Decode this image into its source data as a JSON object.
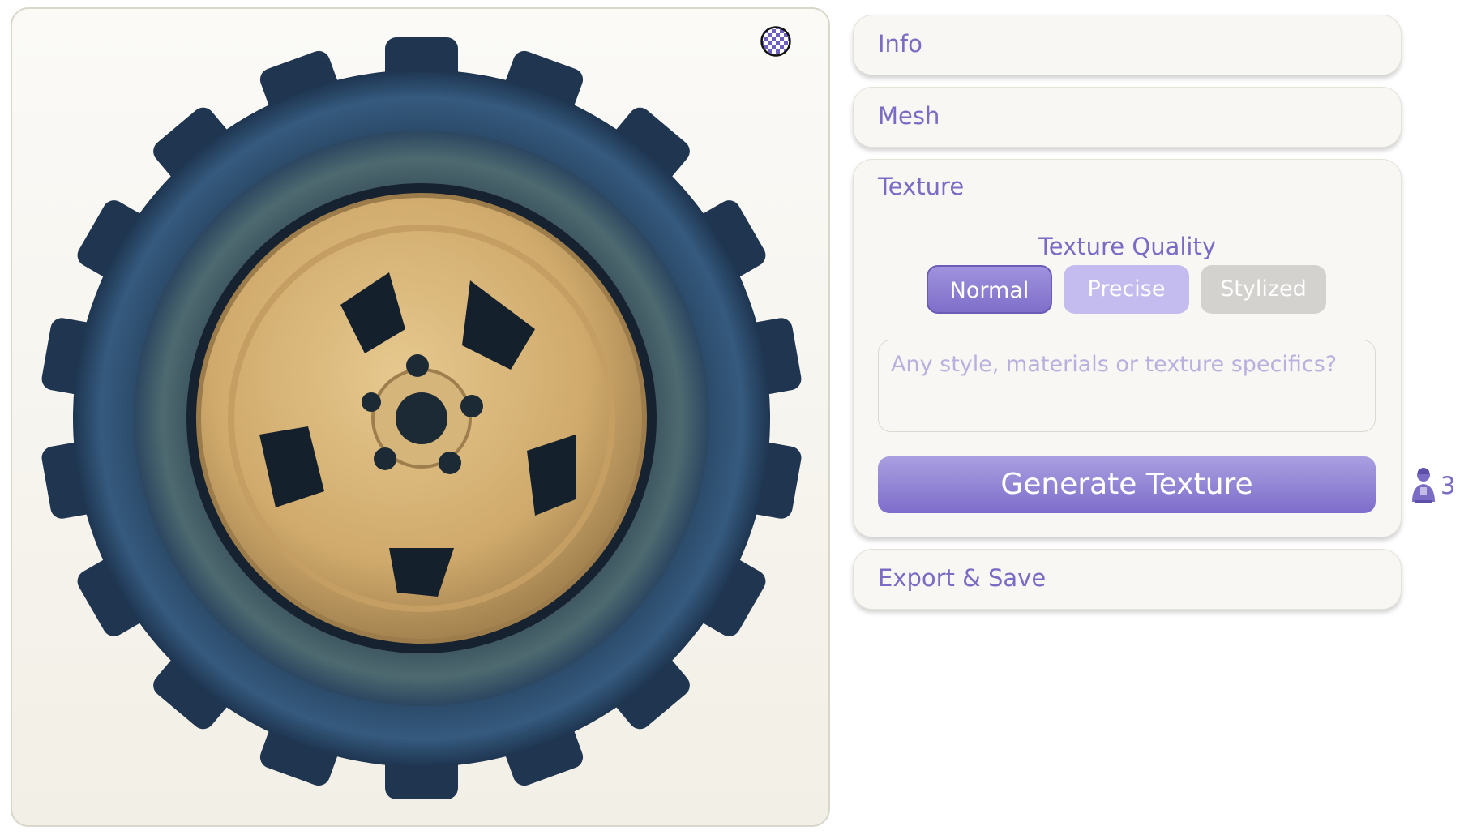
{
  "sections": {
    "info": {
      "title": "Info"
    },
    "mesh": {
      "title": "Mesh"
    },
    "texture": {
      "title": "Texture",
      "quality_label": "Texture Quality",
      "quality_options": [
        "Normal",
        "Precise",
        "Stylized"
      ],
      "selected_quality": "Normal",
      "prompt_placeholder": "Any style, materials or texture specifics?",
      "prompt_value": "",
      "generate_label": "Generate Texture"
    },
    "export": {
      "title": "Export & Save"
    }
  },
  "credits": {
    "count": "3",
    "icon": "user-figure-icon"
  },
  "viewport": {
    "background_toggle_icon": "checkerboard-icon",
    "preview_subject": "wheel-model"
  },
  "colors": {
    "accent": "#7a6bc4",
    "accent_button": "#8e7fd2",
    "secondary_button": "#c4bbee",
    "disabled_button": "#d4d2ce",
    "panel_bg": "#f8f7f3"
  }
}
